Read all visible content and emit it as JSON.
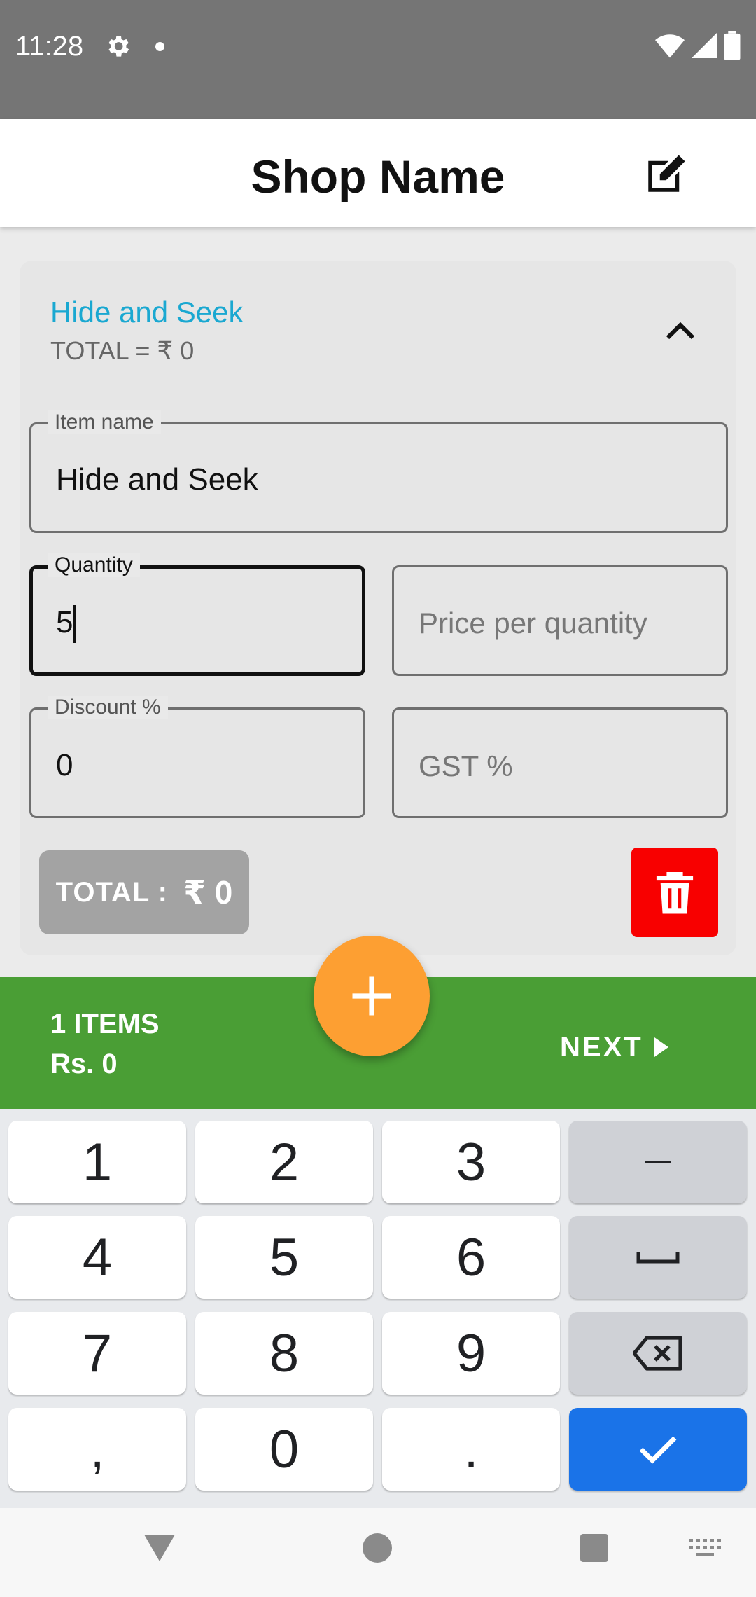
{
  "status_bar": {
    "time": "11:28",
    "icons": [
      "gear-icon",
      "dot-icon",
      "wifi-icon",
      "signal-icon",
      "battery-icon"
    ]
  },
  "app_bar": {
    "title": "Shop Name",
    "edit_icon": "edit-icon"
  },
  "item_card": {
    "title": "Hide and Seek",
    "subtotal": "TOTAL = ₹ 0",
    "collapse_icon": "chevron-up-icon",
    "fields": {
      "item_name": {
        "label": "Item name",
        "value": "Hide and Seek"
      },
      "quantity": {
        "label": "Quantity",
        "value": "5"
      },
      "price": {
        "placeholder": "Price per quantity"
      },
      "discount": {
        "label": "Discount %",
        "value": "0"
      },
      "gst": {
        "placeholder": "GST %"
      }
    },
    "total_label": "TOTAL :",
    "total_value": "₹ 0",
    "delete_icon": "trash-icon"
  },
  "bottom_bar": {
    "items_count": "1 ITEMS",
    "items_amount": "Rs. 0",
    "next_label": "NEXT",
    "add_icon": "plus-icon"
  },
  "keyboard": {
    "rows": [
      [
        "1",
        "2",
        "3",
        "–"
      ],
      [
        "4",
        "5",
        "6",
        "␣"
      ],
      [
        "7",
        "8",
        "9",
        "⌫"
      ],
      [
        ",",
        "0",
        ".",
        "✓"
      ]
    ]
  },
  "colors": {
    "status_bar": "#757575",
    "accent_title": "#1aa8d1",
    "green_bar": "#4a9e35",
    "fab": "#fd9f32",
    "delete": "#f80000",
    "enter_key": "#1a73e8"
  }
}
